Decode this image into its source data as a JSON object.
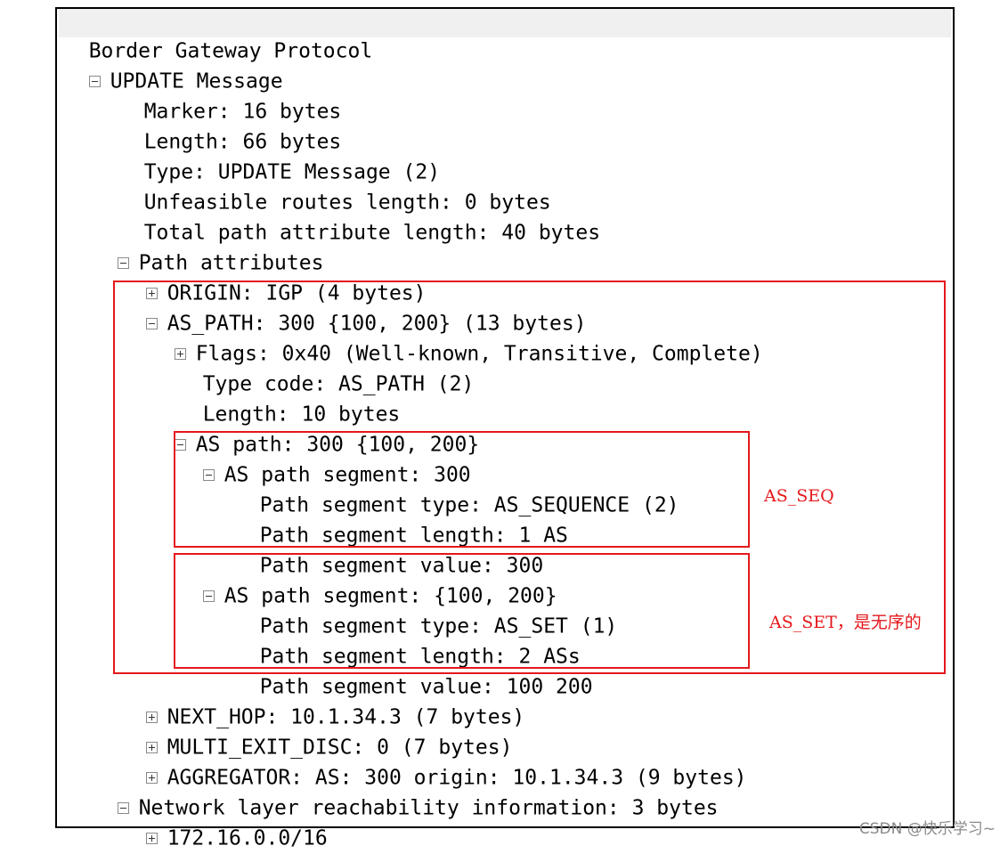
{
  "tree": {
    "protocol_label": "Border Gateway Protocol",
    "update_message": "UPDATE Message",
    "marker": "Marker: 16 bytes",
    "length": "Length: 66 bytes",
    "type": "Type: UPDATE Message (2)",
    "unfeasible": "Unfeasible routes length: 0 bytes",
    "total_path_attr": "Total path attribute length: 40 bytes",
    "path_attributes": "Path attributes",
    "origin": "ORIGIN: IGP (4 bytes)",
    "as_path": "AS_PATH: 300 {100, 200} (13 bytes)",
    "flags": "Flags: 0x40 (Well-known, Transitive, Complete)",
    "type_code": "Type code: AS_PATH (2)",
    "as_path_length": "Length: 10 bytes",
    "as_path_value": "AS path: 300 {100, 200}",
    "seg1": {
      "title": "AS path segment: 300",
      "type": "Path segment type: AS_SEQUENCE (2)",
      "length": "Path segment length: 1 AS",
      "value": "Path segment value: 300"
    },
    "seg2": {
      "title": "AS path segment: {100, 200}",
      "type": "Path segment type: AS_SET (1)",
      "length": "Path segment length: 2 ASs",
      "value": "Path segment value: 100 200"
    },
    "next_hop": "NEXT_HOP: 10.1.34.3 (7 bytes)",
    "med": "MULTI_EXIT_DISC: 0 (7 bytes)",
    "aggregator": "AGGREGATOR: AS: 300 origin: 10.1.34.3 (9 bytes)",
    "nlri": "Network layer reachability information: 3 bytes",
    "prefix": "172.16.0.0/16"
  },
  "annotations": {
    "as_seq": "AS_SEQ",
    "as_set": "AS_SET，是无序的"
  },
  "watermark": "CSDN @快乐学习~",
  "colors": {
    "highlight": "#e4181c",
    "header_background": "#f0f0f0"
  }
}
